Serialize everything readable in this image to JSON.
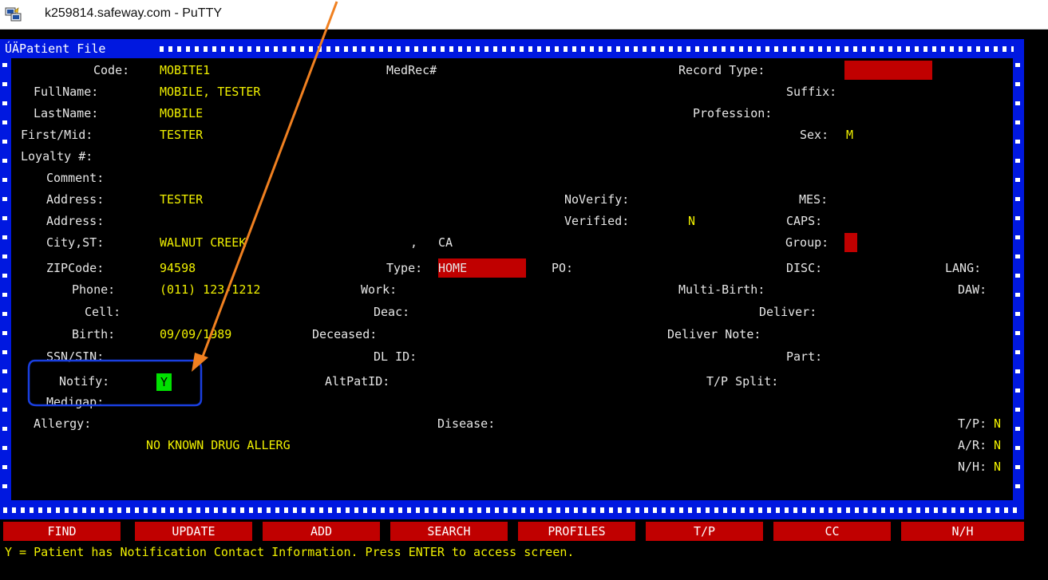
{
  "window": {
    "title": "k259814.safeway.com - PuTTY"
  },
  "screen": {
    "title": "ÚÄPatient File",
    "fields": {
      "code_label": "Code:",
      "code_value": "MOBITE1",
      "medrec_label": "MedRec#",
      "record_type_label": "Record Type:",
      "fullname_label": "FullName:",
      "fullname_value": "MOBILE, TESTER",
      "suffix_label": "Suffix:",
      "lastname_label": "LastName:",
      "lastname_value": "MOBILE",
      "profession_label": "Profession:",
      "firstmid_label": "First/Mid:",
      "firstmid_value": "TESTER",
      "sex_label": "Sex:",
      "sex_value": "M",
      "loyalty_label": "Loyalty #:",
      "comment_label": "Comment:",
      "address1_label": "Address:",
      "address1_value": "TESTER",
      "noverify_label": "NoVerify:",
      "mes_label": "MES:",
      "address2_label": "Address:",
      "verified_label": "Verified:",
      "verified_value": "N",
      "caps_label": "CAPS:",
      "cityst_label": "City,ST:",
      "city_value": "WALNUT CREEK",
      "state_sep": ",",
      "state_value": "CA",
      "group_label": "Group:",
      "zip_label": "ZIPCode:",
      "zip_value": "94598",
      "type_label": "Type:",
      "type_value": "HOME",
      "po_label": "PO:",
      "disc_label": "DISC:",
      "lang_label": "LANG:",
      "phone_label": "Phone:",
      "phone_value": "(011) 123-1212",
      "work_label": "Work:",
      "multibirth_label": "Multi-Birth:",
      "daw_label": "DAW:",
      "cell_label": "Cell:",
      "deac_label": "Deac:",
      "deliver_label": "Deliver:",
      "birth_label": "Birth:",
      "birth_value": "09/09/1989",
      "deceased_label": "Deceased:",
      "delivernote_label": "Deliver Note:",
      "ssn_label": "SSN/SIN:",
      "dlid_label": "DL ID:",
      "part_label": "Part:",
      "notify_label": "Notify:",
      "notify_value": "Y",
      "altpatid_label": "AltPatID:",
      "tpsplit_label": "T/P Split:",
      "medigap_label": "Medigap:",
      "allergy_label": "Allergy:",
      "disease_label": "Disease:",
      "tp_label": "T/P:",
      "tp_value": "N",
      "allergy_text": "NO KNOWN DRUG ALLERG",
      "ar_label": "A/R:",
      "ar_value": "N",
      "nh_label": "N/H:",
      "nh_value": "N"
    }
  },
  "function_keys": [
    "FIND",
    "UPDATE",
    "ADD",
    "SEARCH",
    "PROFILES",
    "T/P",
    "CC",
    "N/H"
  ],
  "status_line": "Y = Patient has Notification Contact Information. Press ENTER to access screen.",
  "colors": {
    "field_label": "#e6e6e6",
    "field_value": "#f0f000",
    "frame": "#0018e0",
    "highlight": "#c00000",
    "cursor": "#00e000",
    "annotation_arrow": "#f08020",
    "annotation_box": "#1a3fe0"
  }
}
